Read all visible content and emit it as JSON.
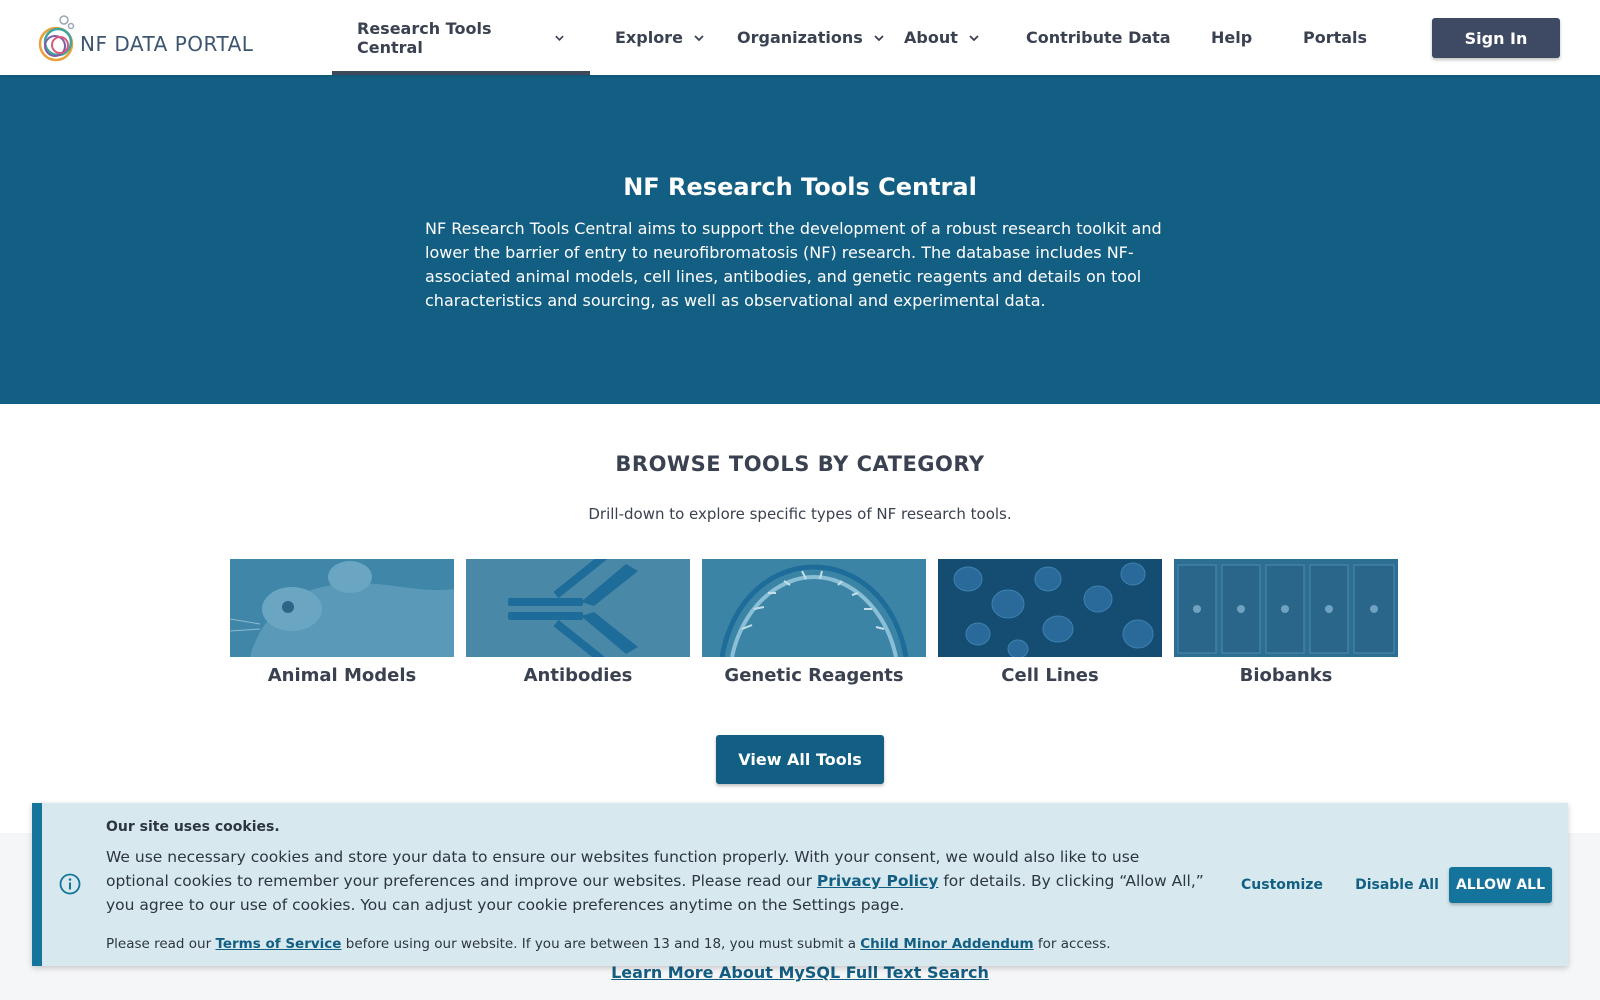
{
  "header": {
    "logo_text": "NF DATA PORTAL",
    "nav": [
      {
        "label": "Research Tools Central",
        "has_dropdown": true,
        "active": true
      },
      {
        "label": "Explore",
        "has_dropdown": true
      },
      {
        "label": "Organizations",
        "has_dropdown": true
      },
      {
        "label": "About",
        "has_dropdown": true
      },
      {
        "label": "Contribute Data",
        "has_dropdown": false
      },
      {
        "label": "Help",
        "has_dropdown": false
      },
      {
        "label": "Portals",
        "has_dropdown": false
      }
    ],
    "sign_in_label": "Sign In"
  },
  "hero": {
    "title": "NF Research Tools Central",
    "description": "NF Research Tools Central aims to support the development of a robust research toolkit and lower the barrier of entry to neurofibromatosis (NF) research. The database includes NF-associated animal models, cell lines, antibodies, and genetic reagents and details on tool characteristics and sourcing, as well as observational and experimental data."
  },
  "browse": {
    "title": "BROWSE TOOLS BY CATEGORY",
    "subtitle": "Drill-down to explore specific types of NF research tools.",
    "categories": [
      {
        "label": "Animal Models",
        "icon": "mouse-image"
      },
      {
        "label": "Antibodies",
        "icon": "antibody-image"
      },
      {
        "label": "Genetic Reagents",
        "icon": "dna-image"
      },
      {
        "label": "Cell Lines",
        "icon": "cells-image"
      },
      {
        "label": "Biobanks",
        "icon": "biobank-image"
      }
    ],
    "view_all_label": "View All Tools"
  },
  "learn_more": "Learn More About MySQL Full Text Search",
  "cookie": {
    "title": "Our site uses cookies.",
    "body_pre": "We use necessary cookies and store your data to ensure our websites function properly. With your consent, we would also like to use optional cookies to remember your preferences and improve our websites. Please read our ",
    "privacy_link": "Privacy Policy",
    "body_post": " for details. By clicking “Allow All,” you agree to our use of cookies. You can adjust your cookie preferences anytime on the Settings page.",
    "foot_pre": "Please read our ",
    "terms_link": "Terms of Service",
    "foot_mid": " before using our website. If you are between 13 and 18, you must submit a ",
    "addendum_link": "Child Minor Addendum",
    "foot_post": " for access.",
    "customize_label": "Customize",
    "disable_label": "Disable All",
    "allow_label": "ALLOW ALL"
  },
  "colors": {
    "brand": "#135f83",
    "signin_bg": "#3e4a63",
    "cookie_bg": "#d7e9ef",
    "cookie_accent": "#14749b"
  }
}
